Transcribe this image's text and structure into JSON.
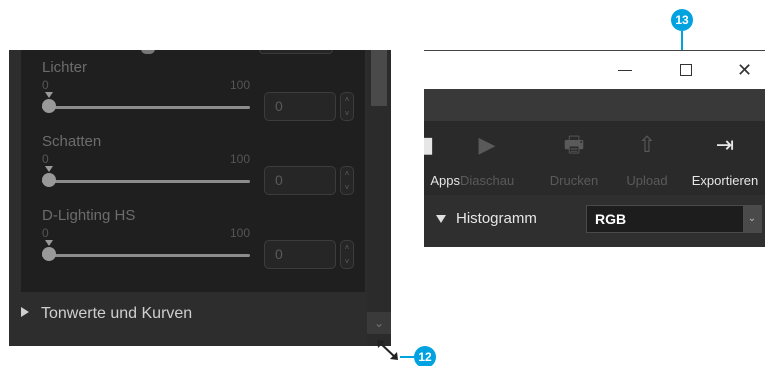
{
  "left_panel": {
    "sliders": [
      {
        "label": "Lichter",
        "min": "0",
        "max": "100",
        "value": "0"
      },
      {
        "label": "Schatten",
        "min": "0",
        "max": "100",
        "value": "0"
      },
      {
        "label": "D-Lighting HS",
        "min": "0",
        "max": "100",
        "value": "0"
      }
    ],
    "spin_up": "˄",
    "spin_down": "˅",
    "scroll_down_glyph": "⌄",
    "section_label": "Tonwerte und Kurven"
  },
  "window": {
    "minimize_glyph": "",
    "close_glyph": "✕",
    "toolbar": [
      {
        "label": "Apps",
        "icon": "apps-icon",
        "glyph": "▮",
        "enabled": true
      },
      {
        "label": "Diaschau",
        "icon": "slideshow-icon",
        "glyph": "▶",
        "enabled": false
      },
      {
        "label": "Drucken",
        "icon": "printer-icon",
        "glyph": "🖶",
        "enabled": false
      },
      {
        "label": "Upload",
        "icon": "upload-icon",
        "glyph": "⇧",
        "enabled": false
      },
      {
        "label": "Exportieren",
        "icon": "export-icon",
        "glyph": "⇥",
        "enabled": true
      }
    ],
    "histogram": {
      "label": "Histogramm",
      "selected": "RGB"
    }
  },
  "callouts": {
    "resize": "12",
    "maximize": "13"
  },
  "colors": {
    "callout": "#00a3e0",
    "panel_bg": "#2d2d2d",
    "toolbar_bg": "#2a2a2a"
  }
}
